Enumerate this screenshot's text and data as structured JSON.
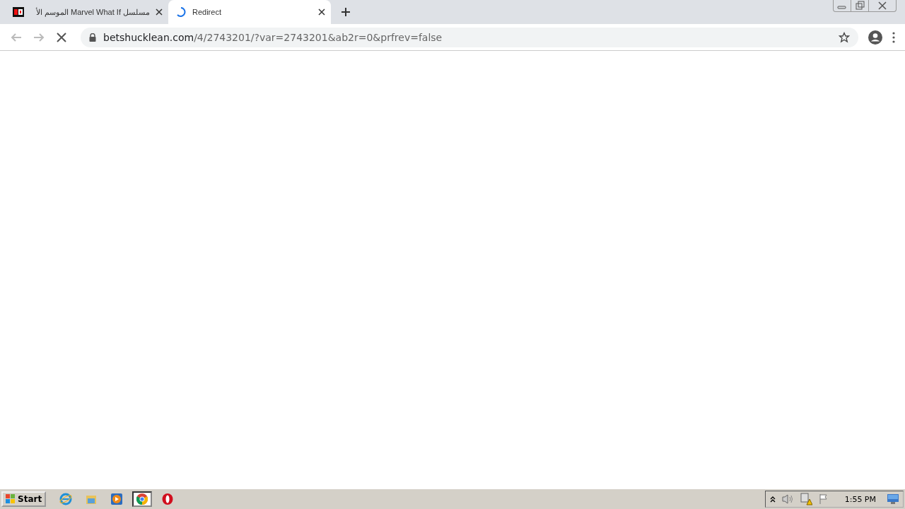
{
  "tabs": [
    {
      "title": "مسلسل Marvel What If الموسم الأ",
      "selected": false,
      "loading": false
    },
    {
      "title": "Redirect",
      "selected": true,
      "loading": true
    }
  ],
  "toolbar": {
    "back_disabled": true,
    "forward_disabled": true,
    "loading": true
  },
  "address": {
    "host": "betshucklean.com",
    "path": "/4/2743201/?var=2743201&ab2r=0&prfrev=false",
    "bookmarked": false
  },
  "taskbar": {
    "start": "Start",
    "apps": [
      {
        "kind": "ie",
        "selected": false
      },
      {
        "kind": "explorer",
        "selected": false
      },
      {
        "kind": "media",
        "selected": false
      },
      {
        "kind": "chrome",
        "selected": true
      },
      {
        "kind": "opera",
        "selected": false
      }
    ],
    "clock": "1:55 PM"
  }
}
